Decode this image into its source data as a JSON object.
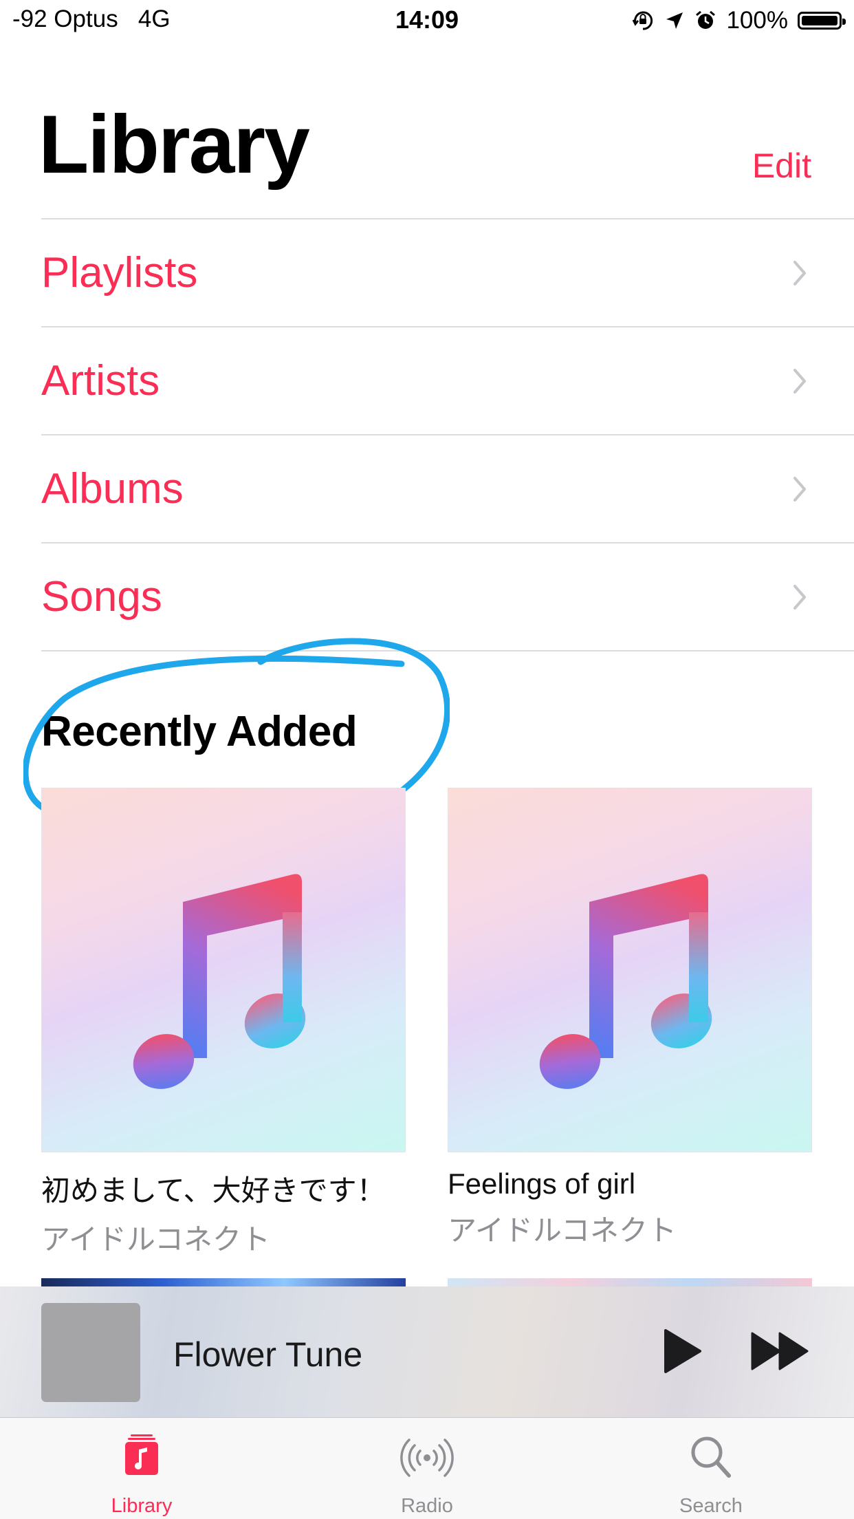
{
  "status_bar": {
    "carrier": "-92 Optus   4G",
    "time": "14:09",
    "battery": "100%",
    "icons": [
      "orientation-lock-icon",
      "location-arrow-icon",
      "alarm-icon",
      "battery-icon"
    ]
  },
  "header": {
    "title": "Library",
    "edit_label": "Edit"
  },
  "menu": {
    "items": [
      {
        "label": "Playlists"
      },
      {
        "label": "Artists"
      },
      {
        "label": "Albums"
      },
      {
        "label": "Songs"
      }
    ]
  },
  "recently_added": {
    "title": "Recently Added",
    "albums": [
      {
        "title": "初めまして、大好きです！",
        "artist": "アイドルコネクト"
      },
      {
        "title": "Feelings of girl",
        "artist": "アイドルコネクト"
      }
    ]
  },
  "mini_player": {
    "track_title": "Flower Tune"
  },
  "tab_bar": {
    "tabs": [
      {
        "label": "Library",
        "icon": "library-icon",
        "active": true
      },
      {
        "label": "Radio",
        "icon": "radio-icon",
        "active": false
      },
      {
        "label": "Search",
        "icon": "search-icon",
        "active": false
      }
    ]
  },
  "colors": {
    "accent": "#fa2d55",
    "highlight_circle": "#1ea7ea",
    "secondary_text": "#8e8e93"
  }
}
